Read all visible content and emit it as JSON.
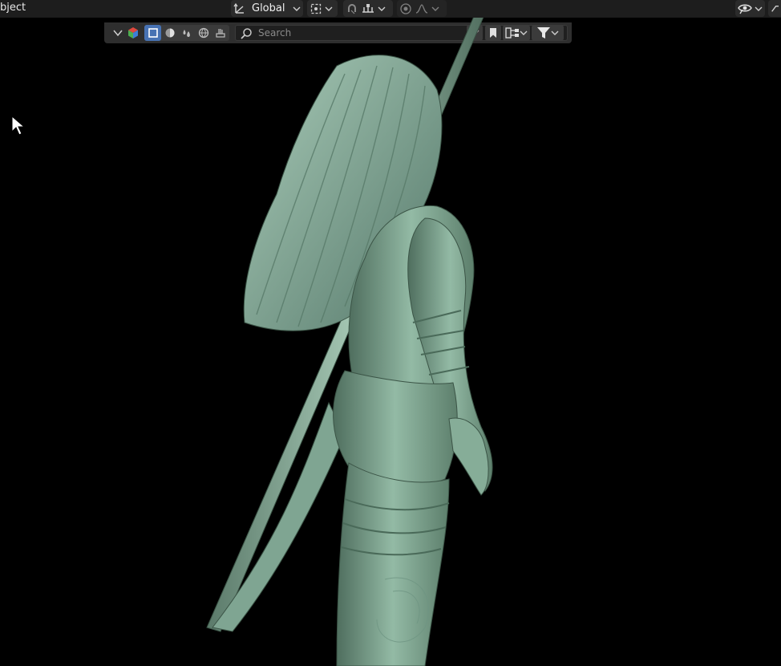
{
  "header": {
    "mode_label": "bject",
    "transform_orientation": "Global",
    "icons": [
      "orientation-gizmo-icon",
      "pivot-point-icon",
      "snap-icon",
      "snap-increment-icon",
      "proportional-edit-icon",
      "falloff-curve-icon",
      "visibility-eye-icon"
    ]
  },
  "filterbar": {
    "search": {
      "placeholder": "Search",
      "value": ""
    },
    "type_filters": [
      "object-mode-icon",
      "solid-sphere-icon",
      "material-drops-icon",
      "world-globe-icon",
      "render-brush-icon"
    ],
    "active_type_filter": "object-mode-icon"
  },
  "viewport": {
    "subject": "3d-sculpt-model",
    "model_color": "#8fb5a0",
    "background": "#000000"
  },
  "colors": {
    "header_bg": "#1d1d1d",
    "button_bg": "#2b2b2b",
    "accent_blue": "#4772b3",
    "filterbar_bg": "#2e2e2e"
  }
}
